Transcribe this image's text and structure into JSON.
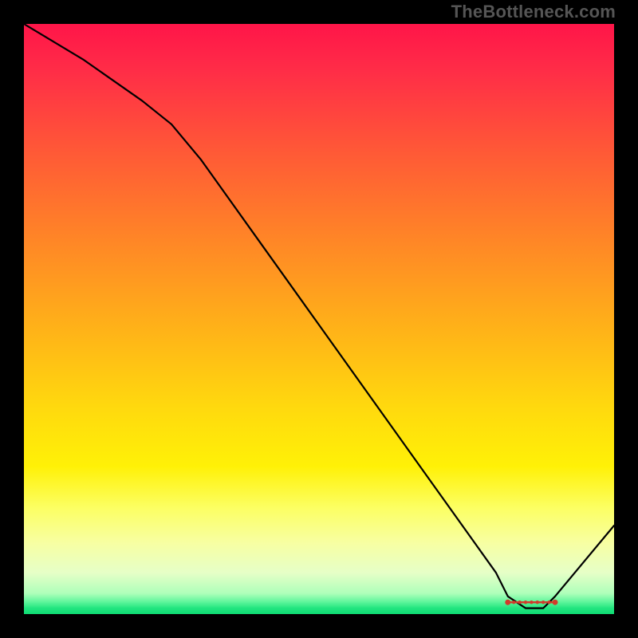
{
  "watermark": "TheBottleneck.com",
  "chart_data": {
    "type": "line",
    "title": "",
    "xlabel": "",
    "ylabel": "",
    "xlim": [
      0,
      100
    ],
    "ylim": [
      0,
      100
    ],
    "grid": false,
    "series": [
      {
        "name": "curve",
        "x": [
          0,
          10,
          20,
          25,
          30,
          40,
          50,
          60,
          70,
          80,
          82,
          85,
          88,
          90,
          100
        ],
        "y": [
          100,
          94,
          87,
          83,
          77,
          63,
          49,
          35,
          21,
          7,
          3,
          1,
          1,
          3,
          15
        ],
        "color": "#000000"
      }
    ],
    "markers": {
      "name": "min_band",
      "xrange": [
        82,
        90
      ],
      "y": 2,
      "color": "#d23b2b"
    }
  }
}
